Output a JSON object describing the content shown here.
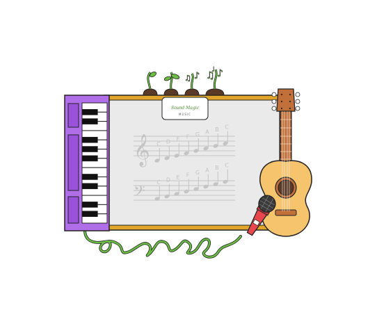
{
  "sign": {
    "title": "Sound Magic",
    "subtitle": "MUSIC"
  },
  "staff": {
    "treble_letters": [
      "C",
      "D",
      "E",
      "F",
      "G",
      "A",
      "B",
      "C"
    ],
    "bass_letters": [
      "C",
      "D",
      "E",
      "F",
      "G",
      "A",
      "B",
      "C"
    ]
  },
  "colors": {
    "board_frame": "#E0A52A",
    "board_surface": "#EAEAEA",
    "keyboard_body": "#B06FE8",
    "guitar_body": "#F7C46E",
    "guitar_neck": "#C2703A",
    "microphone": "#E8474E",
    "cable": "#6CBE45",
    "sprouts": "#6CBE45",
    "pots": "#5A3A26"
  },
  "icons": {
    "keyboard": "piano-keyboard-icon",
    "guitar": "acoustic-guitar-icon",
    "microphone": "microphone-icon",
    "sprouts": "music-note-sprout-icon"
  }
}
